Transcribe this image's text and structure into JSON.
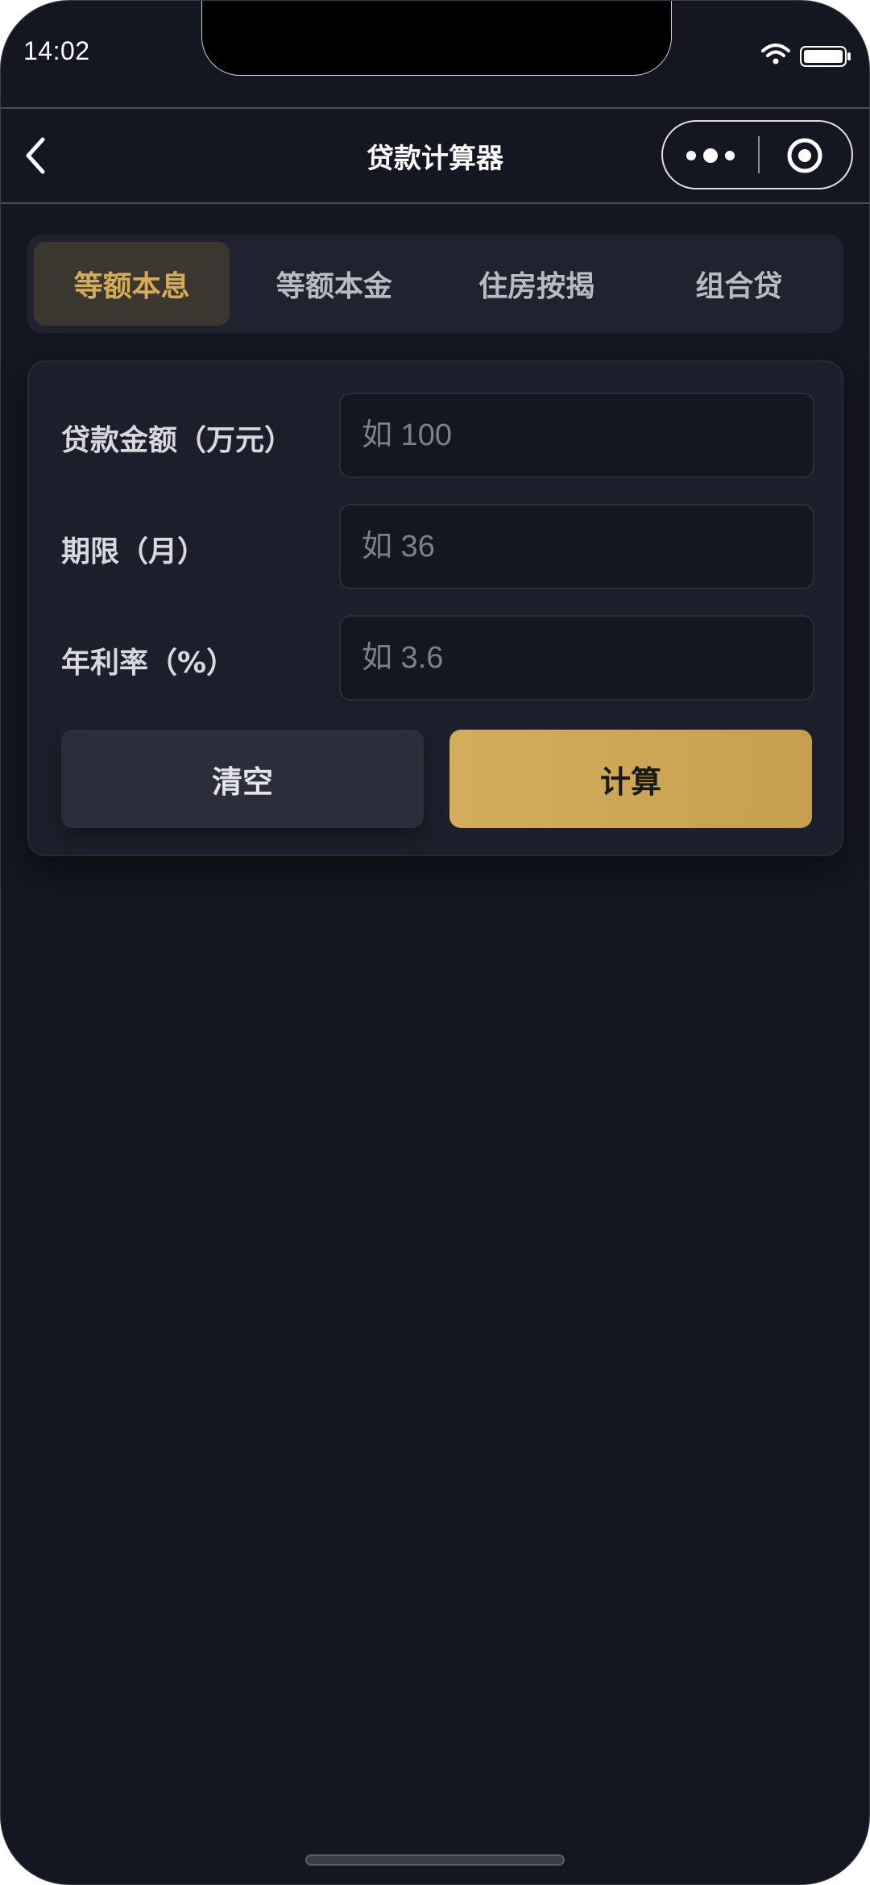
{
  "status_bar": {
    "time": "14:02",
    "icons": [
      "wifi-icon",
      "battery-icon"
    ]
  },
  "navbar": {
    "title": "贷款计算器",
    "icons": [
      "back-icon",
      "more-icon",
      "close-icon"
    ]
  },
  "tabs": [
    {
      "label": "等额本息",
      "active": true
    },
    {
      "label": "等额本金",
      "active": false
    },
    {
      "label": "住房按揭",
      "active": false
    },
    {
      "label": "组合贷",
      "active": false
    }
  ],
  "form": {
    "fields": [
      {
        "label": "贷款金额（万元）",
        "placeholder": "如 100",
        "value": ""
      },
      {
        "label": "期限（月）",
        "placeholder": "如 36",
        "value": ""
      },
      {
        "label": "年利率（%）",
        "placeholder": "如 3.6",
        "value": ""
      }
    ],
    "clear_label": "清空",
    "calc_label": "计算"
  },
  "colors": {
    "background": "#141622",
    "accent": "#d5ab58",
    "card": "#1c1f2b"
  }
}
